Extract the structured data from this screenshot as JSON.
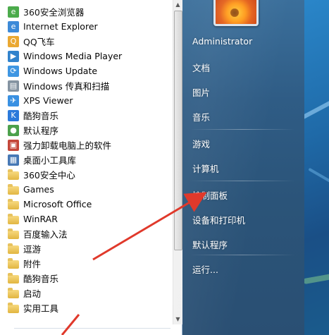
{
  "programs": {
    "items": [
      {
        "label": "360安全浏览器",
        "icon": "360-browser-icon",
        "color": "#3aa33a",
        "glyph": "e"
      },
      {
        "label": "Internet Explorer",
        "icon": "internet-explorer-icon",
        "color": "#2a7fd4",
        "glyph": "e"
      },
      {
        "label": "QQ飞车",
        "icon": "qq-speed-icon",
        "color": "#e8a020",
        "glyph": "Q"
      },
      {
        "label": "Windows Media Player",
        "icon": "media-player-icon",
        "color": "#1f78c8",
        "glyph": "▶"
      },
      {
        "label": "Windows Update",
        "icon": "windows-update-icon",
        "color": "#2e8de0",
        "glyph": "⟳"
      },
      {
        "label": "Windows 传真和扫描",
        "icon": "fax-scan-icon",
        "color": "#7a8a99",
        "glyph": "▤"
      },
      {
        "label": "XPS Viewer",
        "icon": "xps-viewer-icon",
        "color": "#2a88e0",
        "glyph": "✈"
      },
      {
        "label": "酷狗音乐",
        "icon": "kugou-music-icon",
        "color": "#1b6fd8",
        "glyph": "K"
      },
      {
        "label": "默认程序",
        "icon": "default-programs-icon",
        "color": "#3f9a3f",
        "glyph": "●"
      },
      {
        "label": "强力卸载电脑上的软件",
        "icon": "uninstall-icon",
        "color": "#c0392b",
        "glyph": "▣"
      },
      {
        "label": "桌面小工具库",
        "icon": "gadgets-icon",
        "color": "#3a6fb0",
        "glyph": "▦"
      },
      {
        "label": "360安全中心",
        "icon": "folder-icon",
        "folder": true
      },
      {
        "label": "Games",
        "icon": "folder-icon",
        "folder": true
      },
      {
        "label": "Microsoft Office",
        "icon": "folder-icon",
        "folder": true
      },
      {
        "label": "WinRAR",
        "icon": "folder-icon",
        "folder": true
      },
      {
        "label": "百度输入法",
        "icon": "folder-icon",
        "folder": true
      },
      {
        "label": "逗游",
        "icon": "folder-icon",
        "folder": true
      },
      {
        "label": "附件",
        "icon": "folder-icon",
        "folder": true
      },
      {
        "label": "酷狗音乐",
        "icon": "folder-icon",
        "folder": true
      },
      {
        "label": "启动",
        "icon": "folder-icon",
        "folder": true
      },
      {
        "label": "实用工具",
        "icon": "folder-icon",
        "folder": true
      }
    ]
  },
  "right_pane": {
    "user": "Administrator",
    "documents": "文档",
    "pictures": "图片",
    "music": "音乐",
    "games": "游戏",
    "computer": "计算机",
    "control_panel": "控制面板",
    "devices_printers": "设备和打印机",
    "default_programs": "默认程序",
    "run": "运行..."
  },
  "colors": {
    "annotation_arrow": "#e0392b",
    "menu_glass": "#2f5c85"
  }
}
